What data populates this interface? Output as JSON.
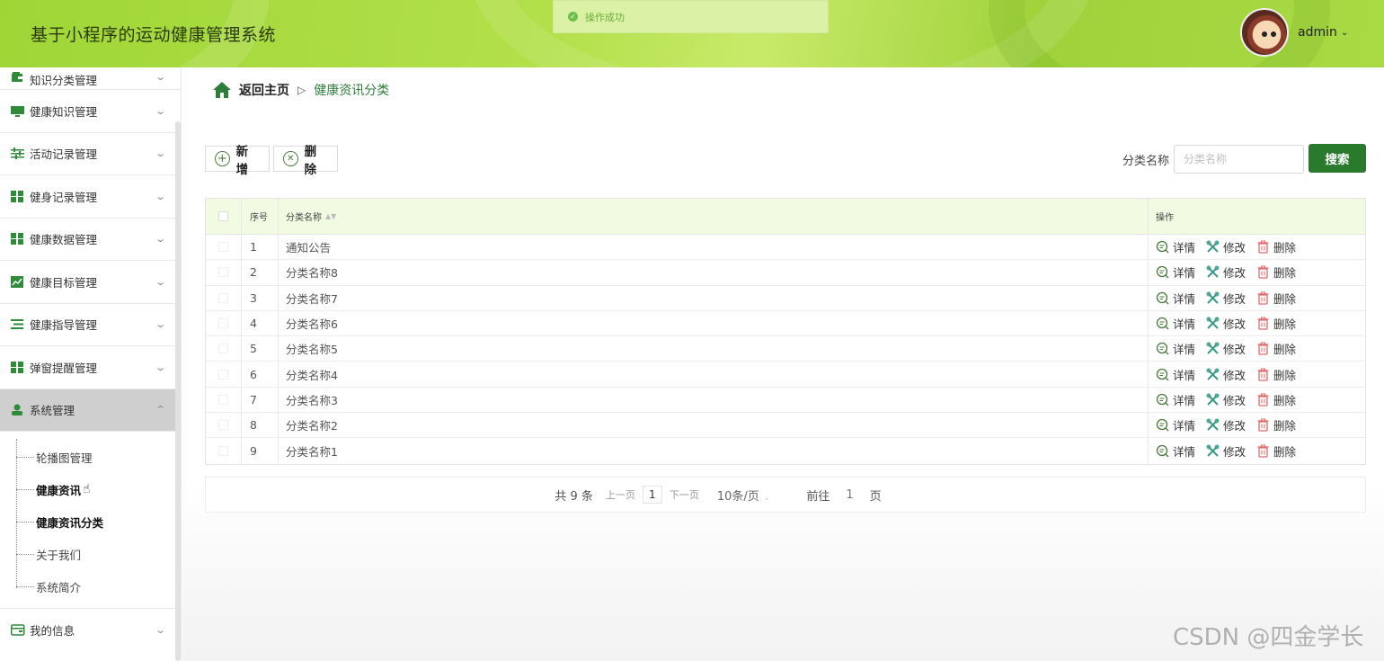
{
  "header": {
    "title": "基于小程序的运动健康管理系统",
    "user": "admin",
    "toast": "操作成功"
  },
  "sidebar": {
    "items": [
      {
        "label": "知识分类管理",
        "icon": "wallet-icon"
      },
      {
        "label": "健康知识管理",
        "icon": "monitor-icon"
      },
      {
        "label": "活动记录管理",
        "icon": "sliders-icon"
      },
      {
        "label": "健身记录管理",
        "icon": "grid-icon"
      },
      {
        "label": "健康数据管理",
        "icon": "grid-icon"
      },
      {
        "label": "健康目标管理",
        "icon": "chart-icon"
      },
      {
        "label": "健康指导管理",
        "icon": "list-icon"
      },
      {
        "label": "弹窗提醒管理",
        "icon": "grid-icon"
      },
      {
        "label": "系统管理",
        "icon": "user-icon"
      }
    ],
    "sub_items": [
      "轮播图管理",
      "健康资讯",
      "健康资讯分类",
      "关于我们",
      "系统简介"
    ],
    "bottom_item": "我的信息"
  },
  "breadcrumb": {
    "home": "返回主页",
    "current": "健康资讯分类"
  },
  "toolbar": {
    "add": "新增",
    "delete": "删除",
    "search_label": "分类名称",
    "search_placeholder": "分类名称",
    "search_btn": "搜索"
  },
  "table": {
    "headers": {
      "index": "序号",
      "name": "分类名称",
      "ops": "操作"
    },
    "rows": [
      {
        "index": "1",
        "name": "通知公告"
      },
      {
        "index": "2",
        "name": "分类名称8"
      },
      {
        "index": "3",
        "name": "分类名称7"
      },
      {
        "index": "4",
        "name": "分类名称6"
      },
      {
        "index": "5",
        "name": "分类名称5"
      },
      {
        "index": "6",
        "name": "分类名称4"
      },
      {
        "index": "7",
        "name": "分类名称3"
      },
      {
        "index": "8",
        "name": "分类名称2"
      },
      {
        "index": "9",
        "name": "分类名称1"
      }
    ],
    "ops": {
      "detail": "详情",
      "edit": "修改",
      "del": "删除"
    }
  },
  "pagination": {
    "total": "共 9 条",
    "prev": "上一页",
    "page": "1",
    "next": "下一页",
    "size": "10条/页",
    "goto": "前往",
    "goto_page": "1",
    "page_unit": "页"
  },
  "watermark": "CSDN @四金学长",
  "colors": {
    "accent": "#2a7a2e",
    "header": "#a9da44",
    "table_head": "#f1fbe2"
  }
}
